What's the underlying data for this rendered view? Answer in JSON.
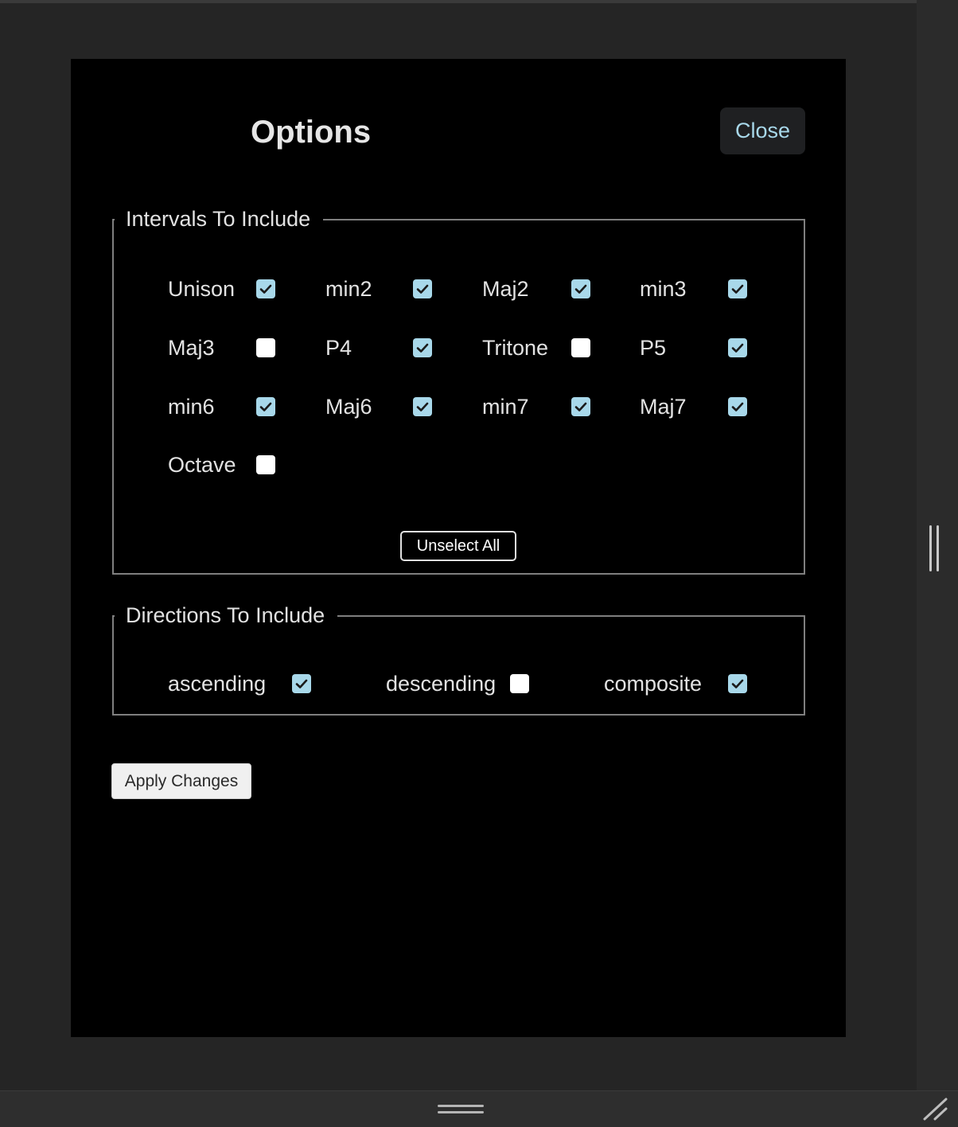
{
  "dialog": {
    "title": "Options",
    "close_label": "Close"
  },
  "intervals": {
    "legend": "Intervals To Include",
    "items": [
      {
        "label": "Unison",
        "checked": true
      },
      {
        "label": "min2",
        "checked": true
      },
      {
        "label": "Maj2",
        "checked": true
      },
      {
        "label": "min3",
        "checked": true
      },
      {
        "label": "Maj3",
        "checked": false
      },
      {
        "label": "P4",
        "checked": true
      },
      {
        "label": "Tritone",
        "checked": false
      },
      {
        "label": "P5",
        "checked": true
      },
      {
        "label": "min6",
        "checked": true
      },
      {
        "label": "Maj6",
        "checked": true
      },
      {
        "label": "min7",
        "checked": true
      },
      {
        "label": "Maj7",
        "checked": true
      },
      {
        "label": "Octave",
        "checked": false
      }
    ],
    "unselect_all_label": "Unselect All"
  },
  "directions": {
    "legend": "Directions To Include",
    "items": [
      {
        "label": "ascending",
        "checked": true
      },
      {
        "label": "descending",
        "checked": false
      },
      {
        "label": "composite",
        "checked": true
      }
    ]
  },
  "apply_label": "Apply Changes",
  "colors": {
    "checkbox_checked": "#a8d8ea",
    "checkbox_unchecked": "#ffffff",
    "close_text": "#a8d8ea",
    "modal_background": "#000000",
    "page_background": "#252525"
  },
  "icons": {
    "checkmark": "checkmark-icon",
    "vertical_resize": "vertical-resize-handle-icon",
    "horizontal_resize": "horizontal-resize-handle-icon",
    "corner_resize": "corner-resize-icon"
  }
}
